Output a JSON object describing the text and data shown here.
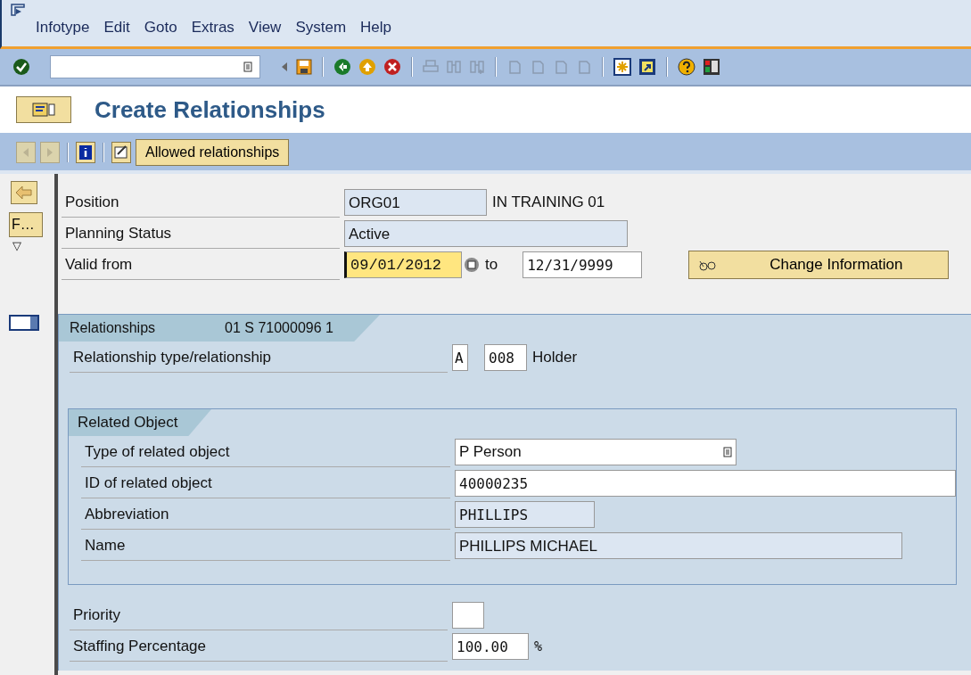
{
  "menu": [
    "Infotype",
    "Edit",
    "Goto",
    "Extras",
    "View",
    "System",
    "Help"
  ],
  "title": "Create Relationships",
  "app_toolbar": {
    "button": "Allowed relationships"
  },
  "side_panel": {
    "button": "F…",
    "toggle": "▽"
  },
  "header_fields": [
    {
      "label": "Position",
      "value": "ORG01",
      "kind": "display",
      "text": "IN TRAINING 01"
    },
    {
      "label": "Planning Status",
      "value": "Active",
      "kind": "display"
    },
    {
      "label": "Valid from",
      "value": "09/01/2012",
      "kind": "focus",
      "to_label": "to",
      "to_value": "12/31/9999"
    }
  ],
  "change_button": "Change Information",
  "relationships": {
    "tab": "Relationships",
    "info": "01 S  71000096 1",
    "row": {
      "label": "Relationship type/relationship",
      "code_a": "A",
      "code_b": "008",
      "text": "Holder"
    },
    "group": {
      "title": "Related Object",
      "rows": [
        {
          "label": "Type of related object",
          "value": "P Person",
          "kind": "dropdown"
        },
        {
          "label": "ID of related object",
          "value": "40000235",
          "kind": "input"
        },
        {
          "label": "Abbreviation",
          "value": "PHILLIPS",
          "kind": "display"
        },
        {
          "label": "Name",
          "value": "PHILLIPS MICHAEL",
          "kind": "display"
        }
      ]
    },
    "bottom_rows": [
      {
        "label": "Priority",
        "kind": "input"
      },
      {
        "label": "Staffing Percentage",
        "value": "100.00",
        "kind": "input",
        "unit": "%"
      }
    ]
  }
}
